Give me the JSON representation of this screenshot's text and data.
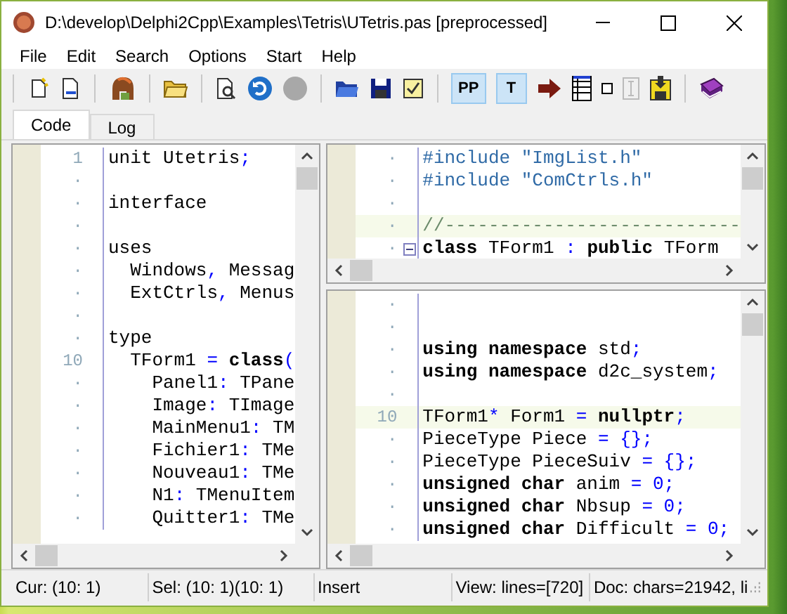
{
  "window": {
    "title": "D:\\develop\\Delphi2Cpp\\Examples\\Tetris\\UTetris.pas [preprocessed]"
  },
  "menu": [
    "File",
    "Edit",
    "Search",
    "Options",
    "Start",
    "Help"
  ],
  "toolbar": {
    "toggles": [
      {
        "label": "PP",
        "selected": true
      },
      {
        "label": "T",
        "selected": true
      }
    ]
  },
  "tabs": [
    {
      "label": "Code",
      "selected": true
    },
    {
      "label": "Log",
      "selected": false
    }
  ],
  "panes": [
    {
      "lines": [
        {
          "number": "1",
          "current": false,
          "fold": false,
          "segments": [
            {
              "text": "unit Utetris",
              "kind": "plain"
            },
            {
              "text": ";",
              "kind": "symbol"
            }
          ]
        },
        {
          "number": "·",
          "current": false,
          "fold": false
        },
        {
          "number": "·",
          "current": false,
          "fold": false,
          "segments": [
            {
              "text": "interface",
              "kind": "plain"
            }
          ]
        },
        {
          "number": "·",
          "current": false,
          "fold": false
        },
        {
          "number": "·",
          "current": false,
          "fold": false,
          "segments": [
            {
              "text": "uses",
              "kind": "plain"
            }
          ]
        },
        {
          "number": "·",
          "current": false,
          "fold": false,
          "segments": [
            {
              "text": "  Windows",
              "kind": "plain"
            },
            {
              "text": ",",
              "kind": "symbol"
            },
            {
              "text": " Messag",
              "kind": "plain"
            }
          ]
        },
        {
          "number": "·",
          "current": false,
          "fold": false,
          "segments": [
            {
              "text": "  ExtCtrls",
              "kind": "plain"
            },
            {
              "text": ",",
              "kind": "symbol"
            },
            {
              "text": " Menus",
              "kind": "plain"
            }
          ]
        },
        {
          "number": "·",
          "current": false,
          "fold": false
        },
        {
          "number": "·",
          "current": false,
          "fold": false,
          "segments": [
            {
              "text": "type",
              "kind": "plain"
            }
          ]
        },
        {
          "number": "10",
          "current": false,
          "fold": false,
          "segments": [
            {
              "text": "  TForm1 ",
              "kind": "plain"
            },
            {
              "text": "=",
              "kind": "symbol"
            },
            {
              "text": " class",
              "kind": "keyword"
            },
            {
              "text": "(",
              "kind": "symbol"
            }
          ]
        },
        {
          "number": "·",
          "current": false,
          "fold": false,
          "segments": [
            {
              "text": "    Panel1",
              "kind": "plain"
            },
            {
              "text": ":",
              "kind": "symbol"
            },
            {
              "text": " TPane",
              "kind": "plain"
            }
          ]
        },
        {
          "number": "·",
          "current": false,
          "fold": false,
          "segments": [
            {
              "text": "    Image",
              "kind": "plain"
            },
            {
              "text": ":",
              "kind": "symbol"
            },
            {
              "text": " TImage",
              "kind": "plain"
            }
          ]
        },
        {
          "number": "·",
          "current": false,
          "fold": false,
          "segments": [
            {
              "text": "    MainMenu1",
              "kind": "plain"
            },
            {
              "text": ":",
              "kind": "symbol"
            },
            {
              "text": " TM",
              "kind": "plain"
            }
          ]
        },
        {
          "number": "·",
          "current": false,
          "fold": false,
          "segments": [
            {
              "text": "    Fichier1",
              "kind": "plain"
            },
            {
              "text": ":",
              "kind": "symbol"
            },
            {
              "text": " TMe",
              "kind": "plain"
            }
          ]
        },
        {
          "number": "·",
          "current": false,
          "fold": false,
          "segments": [
            {
              "text": "    Nouveau1",
              "kind": "plain"
            },
            {
              "text": ":",
              "kind": "symbol"
            },
            {
              "text": " TMe",
              "kind": "plain"
            }
          ]
        },
        {
          "number": "·",
          "current": false,
          "fold": false,
          "segments": [
            {
              "text": "    N1",
              "kind": "plain"
            },
            {
              "text": ":",
              "kind": "symbol"
            },
            {
              "text": " TMenuItem",
              "kind": "plain"
            }
          ]
        },
        {
          "number": "·",
          "current": false,
          "fold": false,
          "segments": [
            {
              "text": "    Quitter1",
              "kind": "plain"
            },
            {
              "text": ":",
              "kind": "symbol"
            },
            {
              "text": " TMe",
              "kind": "plain"
            }
          ]
        }
      ]
    },
    {
      "lines": [
        {
          "number": "·",
          "current": false,
          "fold": false,
          "segments": [
            {
              "text": "#include \"ImgList.h\"",
              "kind": "directive"
            }
          ]
        },
        {
          "number": "·",
          "current": false,
          "fold": false,
          "segments": [
            {
              "text": "#include \"ComCtrls.h\"",
              "kind": "directive"
            }
          ]
        },
        {
          "number": "·",
          "current": false,
          "fold": false
        },
        {
          "number": "·",
          "current": true,
          "fold": false,
          "segments": [
            {
              "text": "//---------------------------",
              "kind": "comment"
            }
          ]
        },
        {
          "number": "·",
          "current": false,
          "fold": true,
          "segments": [
            {
              "text": "class",
              "kind": "keyword"
            },
            {
              "text": " TForm1 ",
              "kind": "plain"
            },
            {
              "text": ":",
              "kind": "symbol"
            },
            {
              "text": " public",
              "kind": "keyword"
            },
            {
              "text": " TForm",
              "kind": "plain"
            }
          ]
        }
      ]
    },
    {
      "lines": [
        {
          "number": "·",
          "current": false,
          "fold": false
        },
        {
          "number": "·",
          "current": false,
          "fold": false
        },
        {
          "number": "·",
          "current": false,
          "fold": false,
          "segments": [
            {
              "text": "using namespace",
              "kind": "keyword"
            },
            {
              "text": " std",
              "kind": "plain"
            },
            {
              "text": ";",
              "kind": "symbol"
            }
          ]
        },
        {
          "number": "·",
          "current": false,
          "fold": false,
          "segments": [
            {
              "text": "using namespace",
              "kind": "keyword"
            },
            {
              "text": " d2c_system",
              "kind": "plain"
            },
            {
              "text": ";",
              "kind": "symbol"
            }
          ]
        },
        {
          "number": "·",
          "current": false,
          "fold": false
        },
        {
          "number": "10",
          "current": true,
          "fold": false,
          "segments": [
            {
              "text": "TForm1",
              "kind": "plain"
            },
            {
              "text": "*",
              "kind": "symbol"
            },
            {
              "text": " Form1 ",
              "kind": "plain"
            },
            {
              "text": "=",
              "kind": "symbol"
            },
            {
              "text": " nullptr",
              "kind": "keyword"
            },
            {
              "text": ";",
              "kind": "symbol"
            }
          ]
        },
        {
          "number": "·",
          "current": false,
          "fold": false,
          "segments": [
            {
              "text": "PieceType Piece ",
              "kind": "plain"
            },
            {
              "text": "= {};",
              "kind": "symbol"
            }
          ]
        },
        {
          "number": "·",
          "current": false,
          "fold": false,
          "segments": [
            {
              "text": "PieceType PieceSuiv ",
              "kind": "plain"
            },
            {
              "text": "= {};",
              "kind": "symbol"
            }
          ]
        },
        {
          "number": "·",
          "current": false,
          "fold": false,
          "segments": [
            {
              "text": "unsigned char",
              "kind": "keyword"
            },
            {
              "text": " anim ",
              "kind": "plain"
            },
            {
              "text": "= 0;",
              "kind": "symbol"
            }
          ]
        },
        {
          "number": "·",
          "current": false,
          "fold": false,
          "segments": [
            {
              "text": "unsigned char",
              "kind": "keyword"
            },
            {
              "text": " Nbsup ",
              "kind": "plain"
            },
            {
              "text": "= 0;",
              "kind": "symbol"
            }
          ]
        },
        {
          "number": "·",
          "current": false,
          "fold": false,
          "segments": [
            {
              "text": "unsigned char",
              "kind": "keyword"
            },
            {
              "text": " Difficult ",
              "kind": "plain"
            },
            {
              "text": "= 0;",
              "kind": "symbol"
            }
          ]
        }
      ]
    }
  ],
  "status_bar": [
    "Cur: (10: 1)",
    "Sel: (10: 1)(10: 1)",
    "Insert",
    "View: lines=[720]",
    "Doc: chars=21942, li"
  ]
}
